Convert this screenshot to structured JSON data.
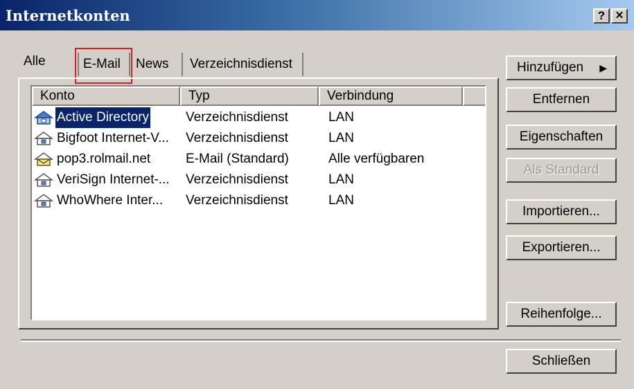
{
  "window": {
    "title": "Internetkonten",
    "help_label": "?",
    "close_label": "✕"
  },
  "tabs": [
    {
      "label": "Alle"
    },
    {
      "label": "E-Mail"
    },
    {
      "label": "News"
    },
    {
      "label": "Verzeichnisdienst"
    }
  ],
  "list": {
    "columns": [
      "Konto",
      "Typ",
      "Verbindung"
    ],
    "rows": [
      {
        "account": "Active Directory",
        "type": "Verzeichnisdienst",
        "connection": "LAN",
        "icon": "directory-service-icon"
      },
      {
        "account": "Bigfoot Internet-V...",
        "type": "Verzeichnisdienst",
        "connection": "LAN",
        "icon": "directory-service-icon"
      },
      {
        "account": "pop3.rolmail.net",
        "type": "E-Mail (Standard)",
        "connection": "Alle verfügbaren",
        "icon": "mail-account-icon"
      },
      {
        "account": "VeriSign Internet-...",
        "type": "Verzeichnisdienst",
        "connection": "LAN",
        "icon": "directory-service-icon"
      },
      {
        "account": "WhoWhere Inter...",
        "type": "Verzeichnisdienst",
        "connection": "LAN",
        "icon": "directory-service-icon"
      }
    ]
  },
  "buttons": {
    "add": "Hinzufügen",
    "remove": "Entfernen",
    "properties": "Eigenschaften",
    "set_default": "Als Standard",
    "import": "Importieren...",
    "export": "Exportieren...",
    "order": "Reihenfolge...",
    "close": "Schließen"
  },
  "colors": {
    "selection": "#0a246a",
    "highlight_box": "#e01b24"
  }
}
